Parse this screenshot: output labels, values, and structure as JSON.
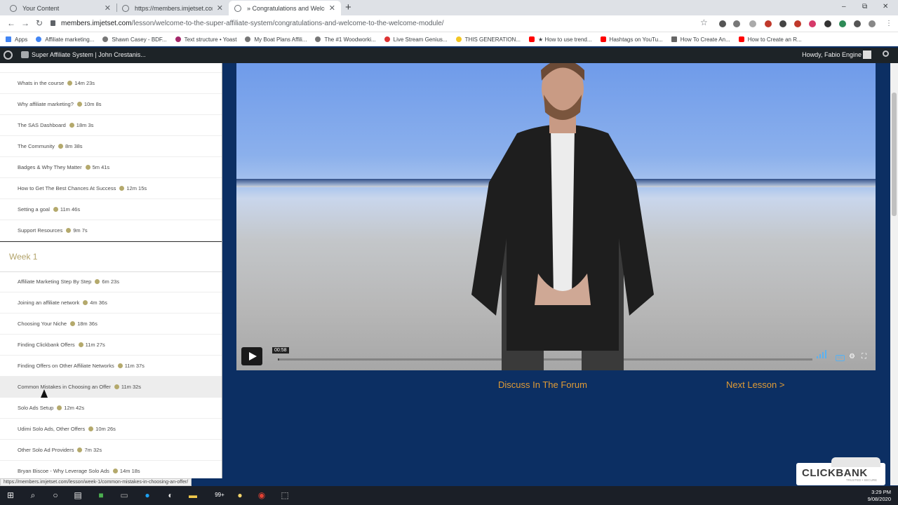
{
  "browser": {
    "tabs": [
      {
        "title": "Your Content"
      },
      {
        "title": "https://members.imjetset.com"
      },
      {
        "title": "» Congratulations and Welcome"
      }
    ],
    "new_tab_label": "+",
    "window_controls": {
      "minimize": "–",
      "restore": "⧉",
      "close": "✕"
    },
    "url_host": "members.imjetset.com",
    "url_path": "/lesson/welcome-to-the-super-affiliate-system/congratulations-and-welcome-to-the-welcome-module/",
    "bookmarks": [
      {
        "label": "Apps"
      },
      {
        "label": "Affiliate marketing..."
      },
      {
        "label": "Shawn Casey - BDF..."
      },
      {
        "label": "Text structure • Yoast"
      },
      {
        "label": "My Boat Plans Affili..."
      },
      {
        "label": "The #1 Woodworki..."
      },
      {
        "label": "Live Stream Genius..."
      },
      {
        "label": "THIS GENERATION..."
      },
      {
        "label": "★ How to use trend..."
      },
      {
        "label": "Hashtags on YouTu..."
      },
      {
        "label": "How To Create An..."
      },
      {
        "label": "How to Create an R..."
      }
    ]
  },
  "wpbar": {
    "site_name": "Super Affiliate System | John Crestanis...",
    "howdy": "Howdy, Fabio Engine"
  },
  "sidebar": {
    "intro_lessons": [
      {
        "title": "Whats in the course",
        "duration": "14m 23s"
      },
      {
        "title": "Why affiliate marketing?",
        "duration": "10m 8s"
      },
      {
        "title": "The SAS Dashboard",
        "duration": "18m 3s"
      },
      {
        "title": "The Community",
        "duration": "8m 38s"
      },
      {
        "title": "Badges & Why They Matter",
        "duration": "5m 41s"
      },
      {
        "title": "How to Get The Best Chances At Success",
        "duration": "12m 15s"
      },
      {
        "title": "Setting a goal",
        "duration": "11m 46s"
      },
      {
        "title": "Support Resources",
        "duration": "9m 7s"
      }
    ],
    "week_label": "Week 1",
    "week1_lessons": [
      {
        "title": "Affiliate Marketing Step By Step",
        "duration": "6m 23s"
      },
      {
        "title": "Joining an affiliate network",
        "duration": "4m 36s"
      },
      {
        "title": "Choosing Your Niche",
        "duration": "18m 36s"
      },
      {
        "title": "Finding Clickbank Offers",
        "duration": "11m 27s"
      },
      {
        "title": "Finding Offers on Other Affiliate Networks",
        "duration": "11m 37s"
      },
      {
        "title": "Common Mistakes in Choosing an Offer",
        "duration": "11m 32s"
      },
      {
        "title": "Solo Ads Setup",
        "duration": "12m 42s"
      },
      {
        "title": "Udimi Solo Ads, Other Offers",
        "duration": "10m 26s"
      },
      {
        "title": "Other Solo Ad Providers",
        "duration": "7m 32s"
      },
      {
        "title": "Bryan Biscoe - Why Leverage Solo Ads",
        "duration": "14m 18s"
      }
    ]
  },
  "video": {
    "timecode": "00:58",
    "progress": 0.003
  },
  "actions": {
    "discuss": "Discuss In The Forum",
    "next": "Next Lesson >"
  },
  "badge": {
    "name": "CLICKBANK",
    "sub": "TRUSTED • SECURE"
  },
  "status_url": "https://members.imjetset.com/lesson/week-1/common-mistakes-in-choosing-an-offer/",
  "taskbar": {
    "badge": "99+",
    "time": "3:29 PM",
    "date": "9/08/2020"
  },
  "colors": {
    "page_bg": "#0c2f63",
    "link_orange": "#e09b35",
    "week_gold": "#b3a46b",
    "wp_bar": "#1d2327"
  }
}
